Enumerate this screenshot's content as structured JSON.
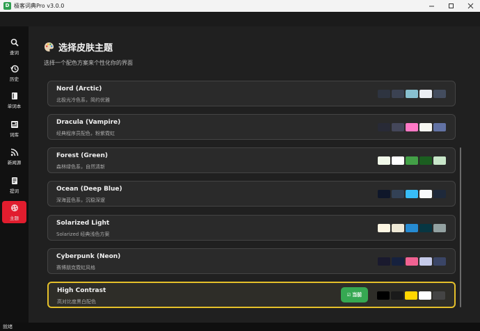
{
  "window": {
    "title": "极客词典Pro v3.0.0",
    "app_icon_glyph": "D"
  },
  "sidebar": {
    "items": [
      {
        "label": "查词",
        "icon": "search-icon"
      },
      {
        "label": "历史",
        "icon": "history-icon"
      },
      {
        "label": "单词本",
        "icon": "book-icon"
      },
      {
        "label": "词库",
        "icon": "library-icon"
      },
      {
        "label": "新闻源",
        "icon": "rss-icon"
      },
      {
        "label": "提词",
        "icon": "document-icon"
      },
      {
        "label": "主题",
        "icon": "palette-icon",
        "active": true
      }
    ]
  },
  "page": {
    "title": "选择皮肤主题",
    "subtitle": "选择一个配色方案来个性化你的界面"
  },
  "themes": [
    {
      "name": "Nord (Arctic)",
      "desc": "北极光冷色系，简约优雅",
      "colors": [
        "#2e3440",
        "#3b4252",
        "#88c0d0",
        "#eceff4",
        "#434c5e"
      ]
    },
    {
      "name": "Dracula (Vampire)",
      "desc": "经典程序员配色，粉紫霓虹",
      "colors": [
        "#282a36",
        "#44475a",
        "#ff79c6",
        "#f8f8f2",
        "#6272a4"
      ]
    },
    {
      "name": "Forest (Green)",
      "desc": "森林绿色系，自然清新",
      "colors": [
        "#f1f8e9",
        "#ffffff",
        "#43a047",
        "#1b5e20",
        "#c8e6c9"
      ]
    },
    {
      "name": "Ocean (Deep Blue)",
      "desc": "深海蓝色系，沉稳深邃",
      "colors": [
        "#0f172a",
        "#334155",
        "#38bdf8",
        "#f8fafc",
        "#1e293b"
      ]
    },
    {
      "name": "Solarized Light",
      "desc": "Solarized 经典浅色方案",
      "colors": [
        "#fdf6e3",
        "#eee8d5",
        "#268bd2",
        "#073642",
        "#93a1a1"
      ]
    },
    {
      "name": "Cyberpunk (Neon)",
      "desc": "赛博朋克霓虹风格",
      "colors": [
        "#1a1a2e",
        "#16213e",
        "#f06292",
        "#c5cae9",
        "#3a4566"
      ]
    },
    {
      "name": "High Contrast",
      "desc": "高对比度黑白配色",
      "colors": [
        "#000000",
        "#1a1a1a",
        "#ffd600",
        "#ffffff",
        "#444444"
      ],
      "current": true,
      "badge": "当前"
    }
  ],
  "status": {
    "text": "就绪"
  }
}
